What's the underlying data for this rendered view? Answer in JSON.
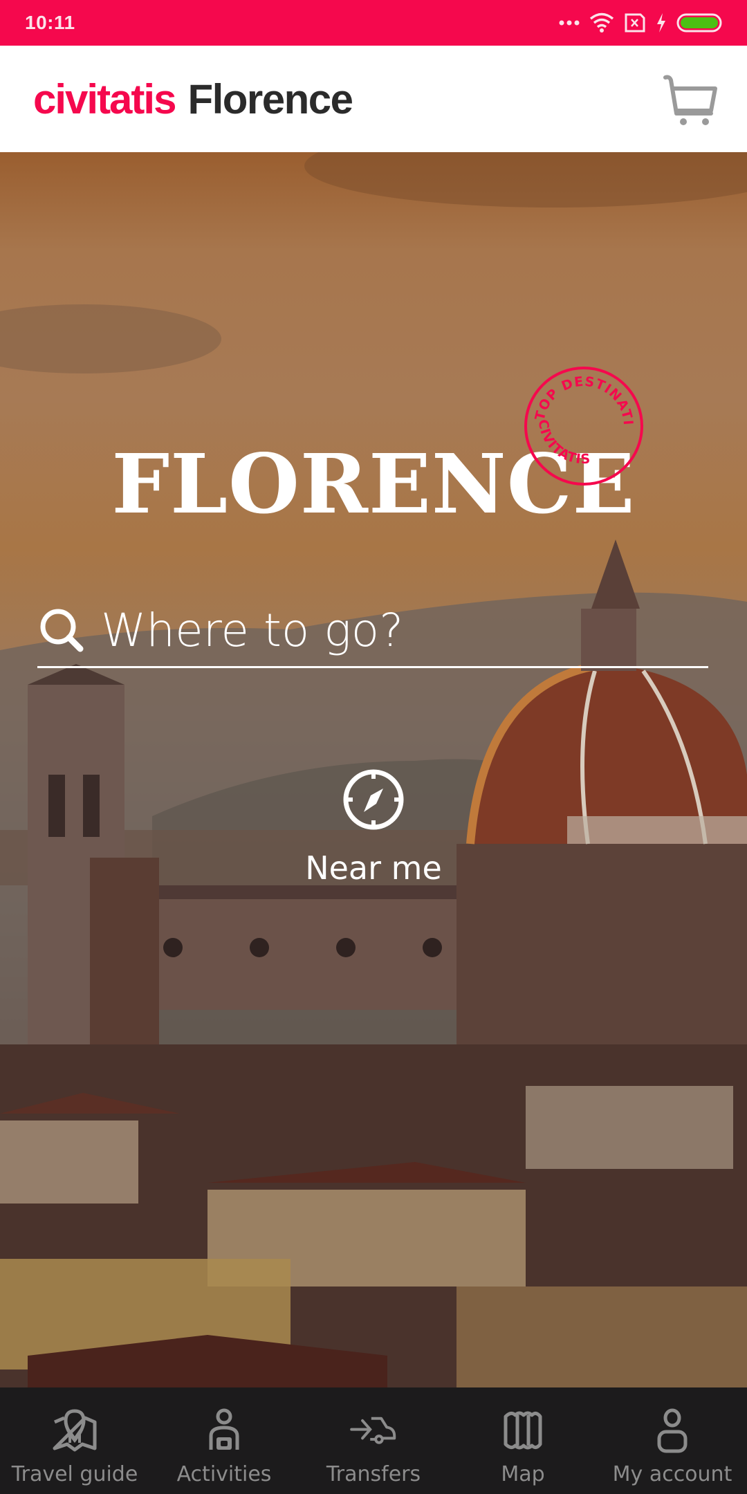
{
  "status_bar": {
    "time": "10:11",
    "icons": [
      "more-dots-icon",
      "wifi-icon",
      "sim-missing-icon",
      "charging-icon",
      "battery-icon"
    ]
  },
  "header": {
    "brand": "civitatis",
    "city": "Florence",
    "cart_icon": "cart-icon"
  },
  "hero": {
    "title": "FLORENCE",
    "badge": {
      "top_text": "TOP DESTINATIONS",
      "bottom_text": "CIVITATIS"
    },
    "search": {
      "placeholder": "Where to go?",
      "value": ""
    },
    "near_me": {
      "label": "Near me",
      "icon": "compass-icon"
    }
  },
  "bottom_nav": {
    "items": [
      {
        "label": "Travel guide",
        "icon": "map-pin-guide-icon"
      },
      {
        "label": "Activities",
        "icon": "activities-person-icon"
      },
      {
        "label": "Transfers",
        "icon": "transfer-car-icon"
      },
      {
        "label": "Map",
        "icon": "map-icon"
      },
      {
        "label": "My account",
        "icon": "account-icon"
      }
    ]
  },
  "colors": {
    "brand": "#f5084d",
    "header_text": "#2b2b2b",
    "nav_background": "#1c1b1c",
    "nav_text": "#8c8c8c",
    "battery": "#4cc013"
  }
}
